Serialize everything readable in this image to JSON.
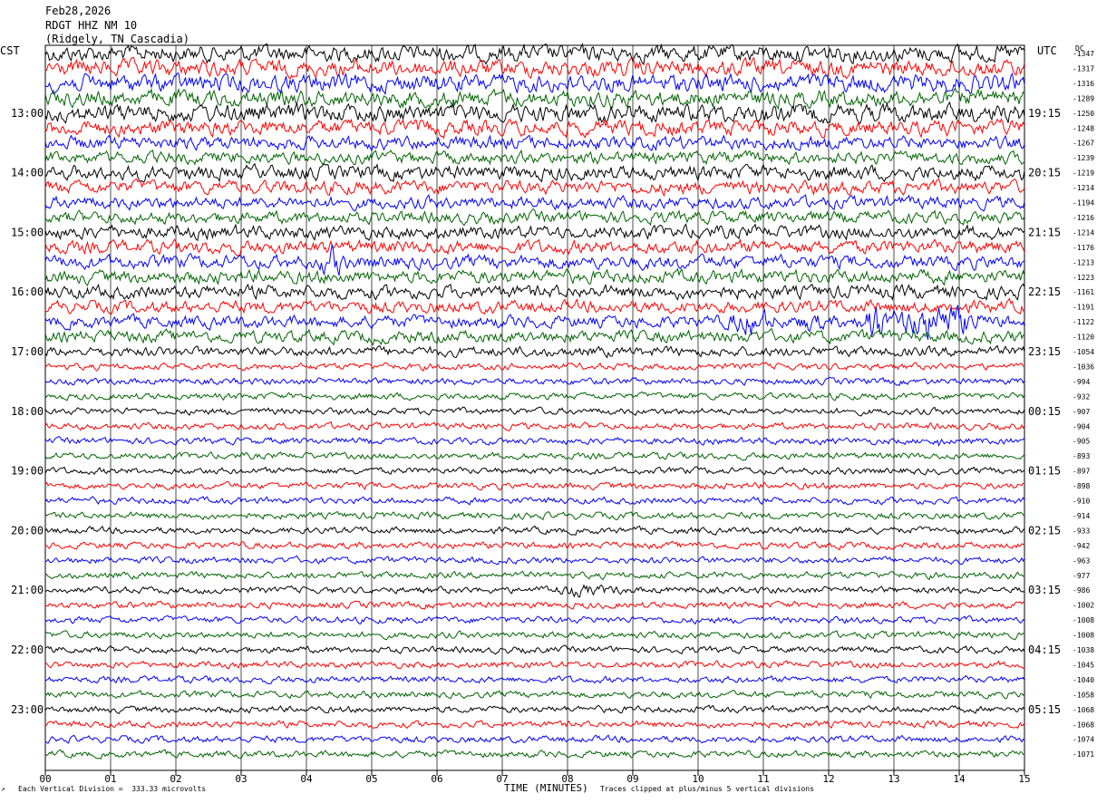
{
  "header": {
    "date": "Feb28,2026",
    "station": "RDGT HHZ NM 10",
    "location": "(Ridgely, TN Cascadia)"
  },
  "left_timezone": "CST",
  "right_timezone": "UTC",
  "dc_label": "DC",
  "footer": {
    "scale_note": "Each Vertical Division =  333.33 microvolts",
    "xlabel": "TIME (MINUTES)",
    "clip_note": "Traces clipped at plus/minus 5 vertical divisions",
    "corner_mark": "↗"
  },
  "colors": [
    "#000000",
    "#ff0000",
    "#0000ff",
    "#006400"
  ],
  "chart_data": {
    "type": "line",
    "title": "RDGT HHZ NM 10",
    "xlabel": "TIME (MINUTES)",
    "xlim": [
      0,
      15
    ],
    "x_ticks": [
      "00",
      "01",
      "02",
      "03",
      "04",
      "05",
      "06",
      "07",
      "08",
      "09",
      "10",
      "11",
      "12",
      "13",
      "14",
      "15"
    ],
    "grid": "vertical lines at each minute",
    "lines_per_hour": 4,
    "left_hour_labels": [
      "13:00",
      "14:00",
      "15:00",
      "16:00",
      "17:00",
      "18:00",
      "19:00",
      "20:00",
      "21:00",
      "22:00",
      "23:00"
    ],
    "right_hour_labels": [
      "19:15",
      "20:15",
      "21:15",
      "22:15",
      "23:15",
      "00:15",
      "01:15",
      "02:15",
      "03:15",
      "04:15",
      "05:15"
    ],
    "dc_offsets": [
      -1347,
      -1317,
      -1316,
      -1289,
      -1250,
      -1248,
      -1267,
      -1239,
      -1219,
      -1214,
      -1194,
      -1216,
      -1214,
      -1176,
      -1213,
      -1223,
      -1161,
      -1191,
      -1122,
      -1120,
      -1054,
      -1036,
      -994,
      -932,
      -907,
      -904,
      -905,
      -893,
      -897,
      -898,
      -910,
      -914,
      -933,
      -942,
      -963,
      -977,
      -986,
      -1002,
      -1008,
      -1008,
      -1038,
      -1045,
      -1040,
      -1058,
      -1068,
      -1068,
      -1074,
      -1071
    ],
    "trace_amplitude": [
      0.75,
      0.75,
      0.8,
      0.75,
      0.8,
      0.7,
      0.6,
      0.55,
      0.65,
      0.6,
      0.55,
      0.55,
      0.6,
      0.6,
      0.6,
      0.6,
      0.6,
      0.55,
      0.55,
      0.55,
      0.45,
      0.3,
      0.3,
      0.3,
      0.3,
      0.3,
      0.3,
      0.3,
      0.3,
      0.3,
      0.3,
      0.3,
      0.3,
      0.3,
      0.3,
      0.3,
      0.3,
      0.3,
      0.3,
      0.3,
      0.3,
      0.3,
      0.3,
      0.3,
      0.3,
      0.3,
      0.3,
      0.3
    ],
    "events": [
      {
        "line": 14,
        "start_min": 4.2,
        "end_min": 4.6,
        "amplitude": 1.6
      },
      {
        "line": 18,
        "start_min": 10.4,
        "end_min": 11.2,
        "amplitude": 1.4
      },
      {
        "line": 18,
        "start_min": 11.4,
        "end_min": 12.0,
        "amplitude": 1.0
      },
      {
        "line": 18,
        "start_min": 12.5,
        "end_min": 12.9,
        "amplitude": 2.2
      },
      {
        "line": 18,
        "start_min": 13.0,
        "end_min": 14.3,
        "amplitude": 1.9
      },
      {
        "line": 26,
        "start_min": 13.65,
        "end_min": 13.72,
        "amplitude": 1.5
      },
      {
        "line": 36,
        "start_min": 7.4,
        "end_min": 9.0,
        "amplitude": 0.6
      }
    ]
  }
}
